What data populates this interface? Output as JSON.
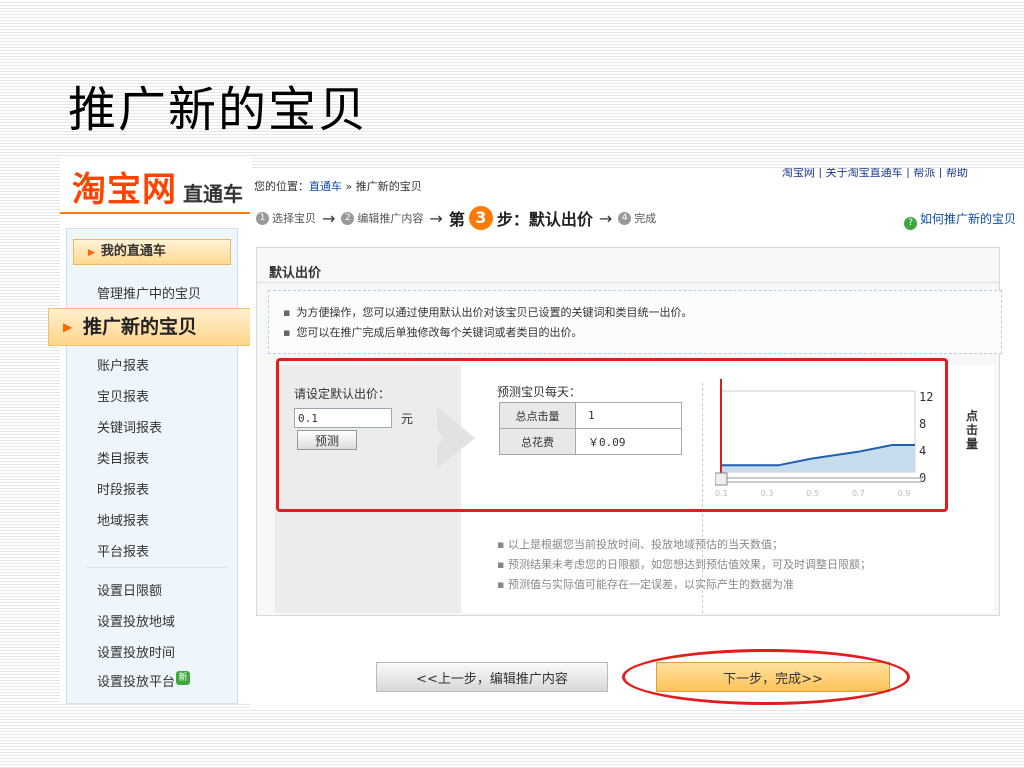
{
  "slide": {
    "title": "推广新的宝贝"
  },
  "logo": {
    "main": "淘宝网",
    "sub": "直通车"
  },
  "top_links": "淘宝网 | 关于淘宝直通车 | 帮派 | 帮助",
  "breadcrumb": {
    "prefix": "您的位置：",
    "link": "直通车",
    "sep": " » ",
    "current": "推广新的宝贝"
  },
  "steps": [
    {
      "num": "1",
      "label": "选择宝贝"
    },
    {
      "num": "2",
      "label": "编辑推广内容"
    },
    {
      "pre": "第",
      "num": "3",
      "post": "步：默认出价"
    },
    {
      "num": "4",
      "label": "完成"
    }
  ],
  "help_link": "如何推广新的宝贝",
  "sidebar": {
    "header": "我的直通车",
    "items": [
      "管理推广中的宝贝",
      "推广新的宝贝",
      "账户报表",
      "宝贝报表",
      "关键词报表",
      "类目报表",
      "时段报表",
      "地域报表",
      "平台报表",
      "设置日限额",
      "设置投放地域",
      "设置投放时间",
      "设置投放平台"
    ],
    "badge": "新"
  },
  "section": {
    "title": "默认出价",
    "tips": [
      "为方便操作，您可以通过使用默认出价对该宝贝已设置的关键词和类目统一出价。",
      "您可以在推广完成后单独修改每个关键词或者类目的出价。"
    ]
  },
  "bid": {
    "label": "请设定默认出价：",
    "value": "0.1",
    "unit": "元",
    "predict_button": "预测"
  },
  "forecast": {
    "label": "预测宝贝每天：",
    "rows": [
      {
        "key": "总点击量",
        "value": "1"
      },
      {
        "key": "总花费",
        "value": "￥0.09"
      }
    ]
  },
  "chart_data": {
    "type": "area",
    "ylabel": "点击量",
    "y_ticks": [
      "12",
      "8",
      "4",
      "0"
    ],
    "x_ticks": [
      "0.1",
      "0.3",
      "0.5",
      "0.7",
      "0.9"
    ],
    "curve": [
      {
        "x": 0.1,
        "y": 1
      },
      {
        "x": 0.3,
        "y": 1
      },
      {
        "x": 0.35,
        "y": 1
      },
      {
        "x": 0.5,
        "y": 2
      },
      {
        "x": 0.7,
        "y": 3
      },
      {
        "x": 0.85,
        "y": 4
      },
      {
        "x": 0.95,
        "y": 4
      }
    ],
    "marker_x": 0.1,
    "colors": {
      "line": "#1f5fb0",
      "fill": "#c7dcef",
      "marker": "#d62020"
    }
  },
  "notes": [
    "以上是根据您当前投放时间、投放地域预估的当天数值；",
    "预测结果未考虑您的日限额，如您想达到预估值效果，可及时调整日限额；",
    "预测值与实际值可能存在一定误差，以实际产生的数据为准"
  ],
  "buttons": {
    "prev": "<<上一步，编辑推广内容",
    "next": "下一步，完成>>"
  },
  "colors": {
    "brand": "#ff4400",
    "accent": "#ff7a00",
    "link": "#0d4fa8",
    "highlight": "#e21d1d"
  }
}
